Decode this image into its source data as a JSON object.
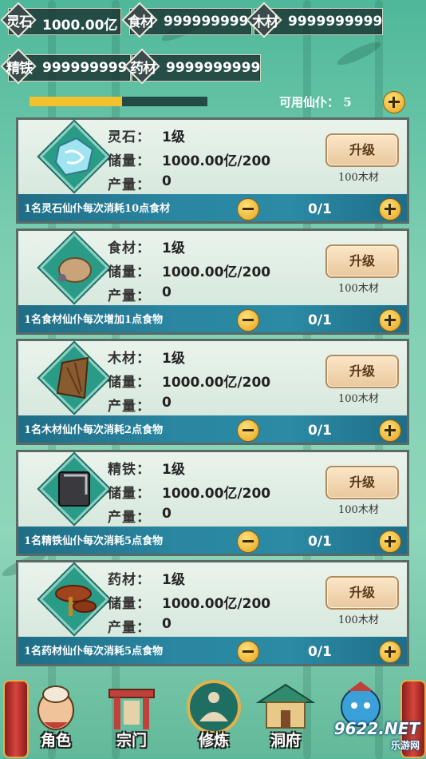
{
  "resources": [
    {
      "tag": "灵石",
      "value": "1000.00亿"
    },
    {
      "tag": "食材",
      "value": "9999999999"
    },
    {
      "tag": "木材",
      "value": "9999999999"
    },
    {
      "tag": "精铁",
      "value": "9999999999"
    },
    {
      "tag": "药材",
      "value": "9999999999"
    }
  ],
  "progress": {
    "fraction": 0.52
  },
  "available_servants": {
    "label": "可用仙仆：",
    "count": "5"
  },
  "labels": {
    "name_suffix": "：",
    "storage": "储量：",
    "output": "产量："
  },
  "cards": [
    {
      "name": "灵石：",
      "level": "1级",
      "storage": "1000.00亿/200",
      "output": "0",
      "upgrade": "升级",
      "cost": "100木材",
      "desc": "1名灵石仙仆每次消耗10点食材",
      "count": "0/1",
      "icon": "spirit-stone-icon"
    },
    {
      "name": "食材：",
      "level": "1级",
      "storage": "1000.00亿/200",
      "output": "0",
      "upgrade": "升级",
      "cost": "100木材",
      "desc": "1名食材仙仆每次增加1点食物",
      "count": "0/1",
      "icon": "food-ingredient-icon"
    },
    {
      "name": "木材：",
      "level": "1级",
      "storage": "1000.00亿/200",
      "output": "0",
      "upgrade": "升级",
      "cost": "100木材",
      "desc": "1名木材仙仆每次消耗2点食物",
      "count": "0/1",
      "icon": "wood-icon"
    },
    {
      "name": "精铁：",
      "level": "1级",
      "storage": "1000.00亿/200",
      "output": "0",
      "upgrade": "升级",
      "cost": "100木材",
      "desc": "1名精铁仙仆每次消耗5点食物",
      "count": "0/1",
      "icon": "iron-icon"
    },
    {
      "name": "药材：",
      "level": "1级",
      "storage": "1000.00亿/200",
      "output": "0",
      "upgrade": "升级",
      "cost": "100木材",
      "desc": "1名药材仙仆每次消耗5点食物",
      "count": "0/1",
      "icon": "herb-icon"
    }
  ],
  "nav": [
    {
      "label": "角色",
      "icon": "character-icon"
    },
    {
      "label": "宗门",
      "icon": "sect-gate-icon"
    },
    {
      "label": "修炼",
      "icon": "cultivate-icon"
    },
    {
      "label": "洞府",
      "icon": "cave-house-icon"
    },
    {
      "label": "",
      "icon": "mascot-icon"
    }
  ],
  "watermark": {
    "top": "9622.NET",
    "bottom": "乐游网"
  }
}
